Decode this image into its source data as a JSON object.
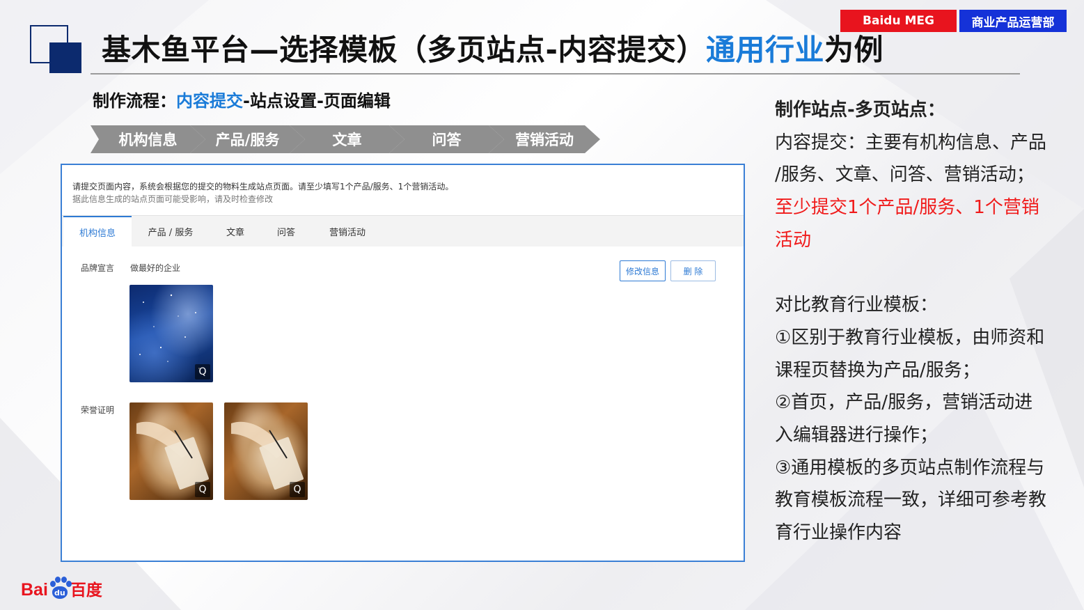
{
  "header": {
    "badge_brand": "Baidu MEG",
    "badge_dept": "商业产品运营部",
    "title_part1": "基木鱼平台—选择模板（多页站点-内容提交）",
    "title_highlight": "通用行业",
    "title_part2": "为例"
  },
  "flow": {
    "label": "制作流程：",
    "current": "内容提交",
    "rest": "-站点设置-页面编辑"
  },
  "steps": [
    "机构信息",
    "产品/服务",
    "文章",
    "问答",
    "营销活动"
  ],
  "panel": {
    "notice_line1": "请提交页面内容，系统会根据您的提交的物料生成站点页面。请至少填写1个产品/服务、1个营销活动。",
    "notice_line2": "据此信息生成的站点页面可能受影响，请及时检查修改",
    "tabs": [
      {
        "label": "机构信息",
        "active": true
      },
      {
        "label": "产品 / 服务",
        "active": false
      },
      {
        "label": "文章",
        "active": false
      },
      {
        "label": "问答",
        "active": false
      },
      {
        "label": "营销活动",
        "active": false
      }
    ],
    "brand_label": "品牌宣言",
    "brand_value": "做最好的企业",
    "edit_button": "修改信息",
    "delete_button": "删 除",
    "honor_label": "荣誉证明",
    "zoom_glyph": "Q"
  },
  "right": {
    "heading": "制作站点-多页站点：",
    "line1": "内容提交：主要有机构信息、产品",
    "line2": "/服务、文章、问答、营销活动；",
    "red1": "至少提交1个产品/服务、1个营销",
    "red2": "活动",
    "compare_heading": "对比教育行业模板：",
    "p1": "①区别于教育行业模板，由师资和",
    "p2": "课程页替换为产品/服务；",
    "p3": "②首页，产品/服务，营销活动进",
    "p4": "入编辑器进行操作；",
    "p5": "③通用模板的多页站点制作流程与",
    "p6": "教育模板流程一致，详细可参考教",
    "p7": "育行业操作内容"
  },
  "logo": {
    "bai": "Bai",
    "du": "du",
    "cn": "百度"
  },
  "colors": {
    "accent_blue": "#1a7bd8",
    "navy": "#0c2a6e",
    "red": "#e8141e",
    "badge_blue": "#1532d8",
    "step_gray": "#8f8f8f"
  }
}
